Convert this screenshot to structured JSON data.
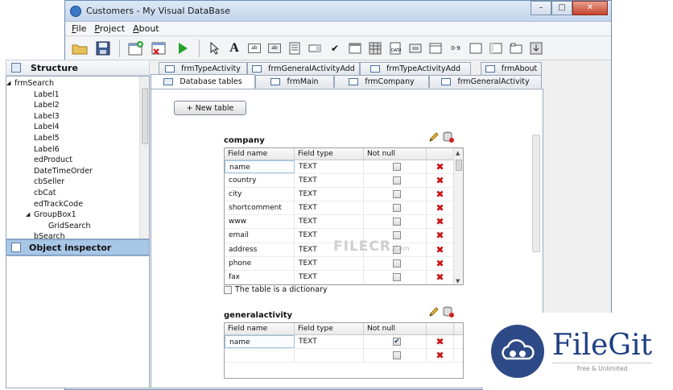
{
  "window": {
    "title": "Customers - My Visual DataBase",
    "minimize": "–",
    "maximize": "□",
    "close": "✕"
  },
  "menu": [
    "File",
    "Project",
    "About"
  ],
  "structure": {
    "title": "Structure",
    "items": [
      {
        "label": "frmSearch",
        "level": 0,
        "expander": "◢"
      },
      {
        "label": "Label1",
        "level": 1
      },
      {
        "label": "Label2",
        "level": 1
      },
      {
        "label": "Label3",
        "level": 1
      },
      {
        "label": "Label4",
        "level": 1
      },
      {
        "label": "Label5",
        "level": 1
      },
      {
        "label": "Label6",
        "level": 1
      },
      {
        "label": "edProduct",
        "level": 1
      },
      {
        "label": "DateTimeOrder",
        "level": 1
      },
      {
        "label": "cbSeller",
        "level": 1
      },
      {
        "label": "cbCat",
        "level": 1
      },
      {
        "label": "edTrackCode",
        "level": 1
      },
      {
        "label": "GroupBox1",
        "level": 1,
        "expander": "◢"
      },
      {
        "label": "GridSearch",
        "level": 2
      },
      {
        "label": "bSearch",
        "level": 1
      }
    ]
  },
  "object_inspector": {
    "title": "Object inspector"
  },
  "tabs": {
    "back_row": [
      "frmTypeActivity",
      "frmGeneralActivityAdd",
      "frmTypeActivityAdd",
      "frmAbout"
    ],
    "front_row": [
      "Database tables",
      "frmMain",
      "frmCompany",
      "frmGeneralActivity"
    ]
  },
  "new_table_label": "+ New table",
  "company": {
    "name": "company",
    "columns": [
      "Field name",
      "Field type",
      "Not null"
    ],
    "rows": [
      {
        "field": "name",
        "type": "TEXT",
        "not_null": false
      },
      {
        "field": "country",
        "type": "TEXT",
        "not_null": false
      },
      {
        "field": "city",
        "type": "TEXT",
        "not_null": false
      },
      {
        "field": "shortcomment",
        "type": "TEXT",
        "not_null": false
      },
      {
        "field": "www",
        "type": "TEXT",
        "not_null": false
      },
      {
        "field": "email",
        "type": "TEXT",
        "not_null": false
      },
      {
        "field": "address",
        "type": "TEXT",
        "not_null": false
      },
      {
        "field": "phone",
        "type": "TEXT",
        "not_null": false
      },
      {
        "field": "fax",
        "type": "TEXT",
        "not_null": false
      }
    ],
    "dictionary_label": "The table is a dictionary"
  },
  "generalactivity": {
    "name": "generalactivity",
    "columns": [
      "Field name",
      "Field type",
      "Not null"
    ],
    "rows": [
      {
        "field": "name",
        "type": "TEXT",
        "not_null": true
      },
      {
        "field": "",
        "type": "",
        "not_null": false
      }
    ]
  },
  "watermarks": {
    "filecr": "FILECR",
    "filecr_sub": ".com",
    "filegit_title": "FileGit",
    "filegit_sub": "Free & Unlimited"
  },
  "colors": {
    "accent": "#2e4a86",
    "delete": "#c81010",
    "selection": "#a8c6e6"
  }
}
